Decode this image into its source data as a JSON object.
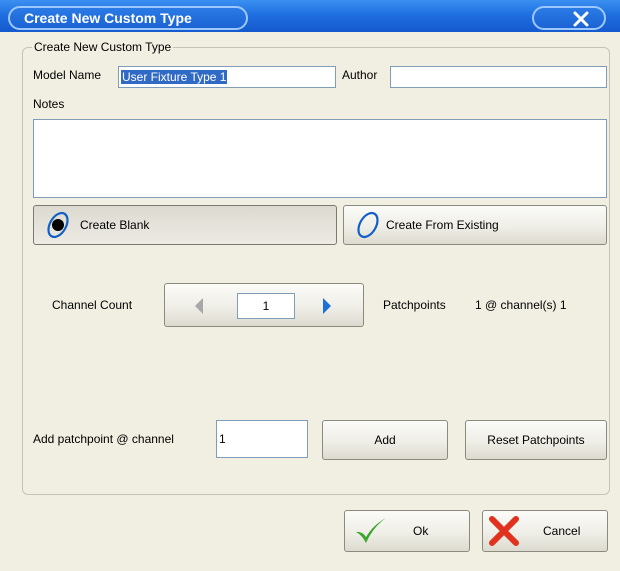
{
  "window": {
    "title": "Create New Custom Type"
  },
  "group": {
    "legend": "Create New Custom Type"
  },
  "form": {
    "model_name_label": "Model Name",
    "model_name_value": "User Fixture Type 1",
    "author_label": "Author",
    "author_value": "",
    "notes_label": "Notes",
    "notes_value": ""
  },
  "mode": {
    "create_blank_label": "Create Blank",
    "create_existing_label": "Create From Existing",
    "selected": "Create Blank"
  },
  "channel": {
    "label": "Channel Count",
    "value": "1",
    "patchpoints_label": "Patchpoints",
    "patchpoints_value": "1 @ channel(s) 1"
  },
  "patch": {
    "add_label": "Add patchpoint @ channel",
    "add_value": "1",
    "add_button": "Add",
    "reset_button": "Reset Patchpoints"
  },
  "footer": {
    "ok_label": "Ok",
    "cancel_label": "Cancel"
  },
  "colors": {
    "titlebar": "#1f6fe0",
    "face": "#f1efe2",
    "ok_check": "#3aa62a",
    "cancel_x": "#e0321e",
    "radio_accent": "#1060c8"
  },
  "icons": [
    "close-icon",
    "radio-selected-icon",
    "radio-unselected-icon",
    "arrow-left-icon",
    "arrow-right-icon",
    "check-icon",
    "x-icon"
  ]
}
